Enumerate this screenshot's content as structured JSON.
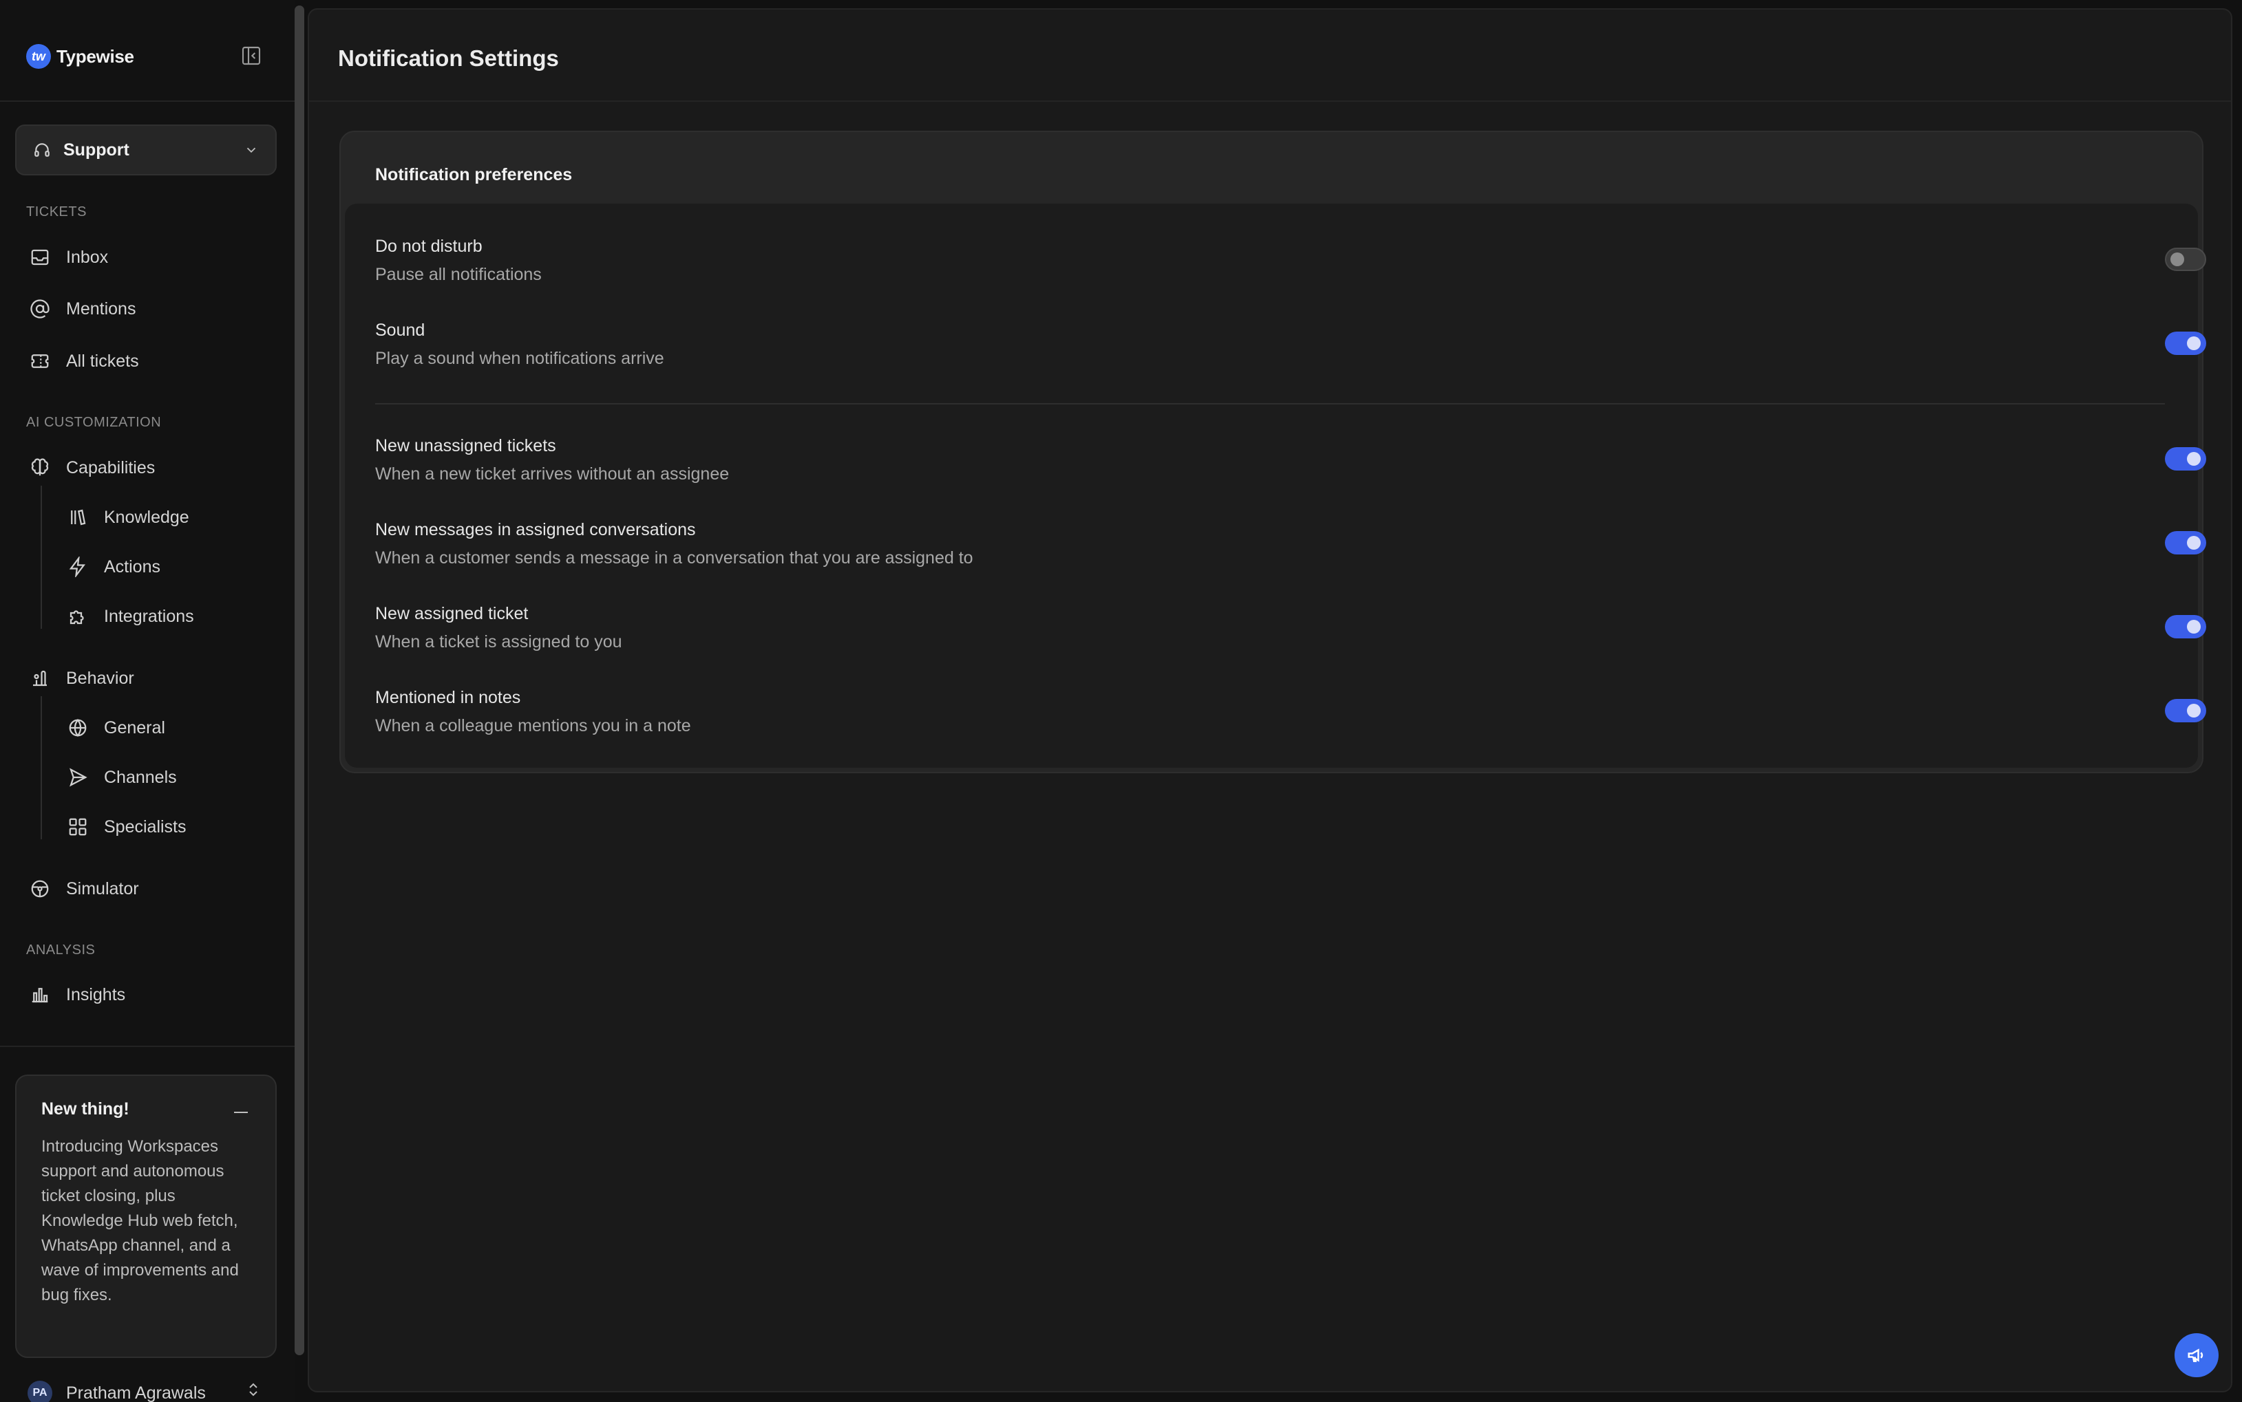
{
  "brand": {
    "name": "Typewise",
    "logo_text": "tw"
  },
  "workspace": {
    "label": "Support"
  },
  "sidebar": {
    "sections": [
      {
        "label": "TICKETS"
      },
      {
        "label": "AI CUSTOMIZATION"
      },
      {
        "label": "ANALYSIS"
      }
    ],
    "items": [
      {
        "label": "Inbox",
        "icon": "inbox-icon"
      },
      {
        "label": "Mentions",
        "icon": "at-sign-icon"
      },
      {
        "label": "All tickets",
        "icon": "ticket-icon"
      },
      {
        "label": "Capabilities",
        "icon": "brain-icon"
      },
      {
        "label": "Knowledge",
        "icon": "library-icon"
      },
      {
        "label": "Actions",
        "icon": "lightning-icon"
      },
      {
        "label": "Integrations",
        "icon": "puzzle-icon"
      },
      {
        "label": "Behavior",
        "icon": "behavior-icon"
      },
      {
        "label": "General",
        "icon": "globe-icon"
      },
      {
        "label": "Channels",
        "icon": "send-icon"
      },
      {
        "label": "Specialists",
        "icon": "grid-icon"
      },
      {
        "label": "Simulator",
        "icon": "steering-wheel-icon"
      },
      {
        "label": "Insights",
        "icon": "bar-chart-icon"
      }
    ]
  },
  "news": {
    "title": "New thing!",
    "body": "Introducing Workspaces support and autonomous ticket closing, plus Knowledge Hub web fetch, WhatsApp channel, and a wave of improvements and bug fixes."
  },
  "user": {
    "name": "Pratham Agrawals",
    "initials": "PA"
  },
  "page": {
    "title": "Notification Settings"
  },
  "preferences": {
    "title": "Notification preferences",
    "rows": [
      {
        "label": "Do not disturb",
        "desc": "Pause all notifications",
        "enabled": false
      },
      {
        "label": "Sound",
        "desc": "Play a sound when notifications arrive",
        "enabled": true
      },
      {
        "label": "New unassigned tickets",
        "desc": "When a new ticket arrives without an assignee",
        "enabled": true
      },
      {
        "label": "New messages in assigned conversations",
        "desc": "When a customer sends a message in a conversation that you are assigned to",
        "enabled": true
      },
      {
        "label": "New assigned ticket",
        "desc": "When a ticket is assigned to you",
        "enabled": true
      },
      {
        "label": "Mentioned in notes",
        "desc": "When a colleague mentions you in a note",
        "enabled": true
      }
    ]
  },
  "colors": {
    "accent": "#3b6df0",
    "toggle_on": "#3b5ee8",
    "background": "#1a1a1a"
  }
}
